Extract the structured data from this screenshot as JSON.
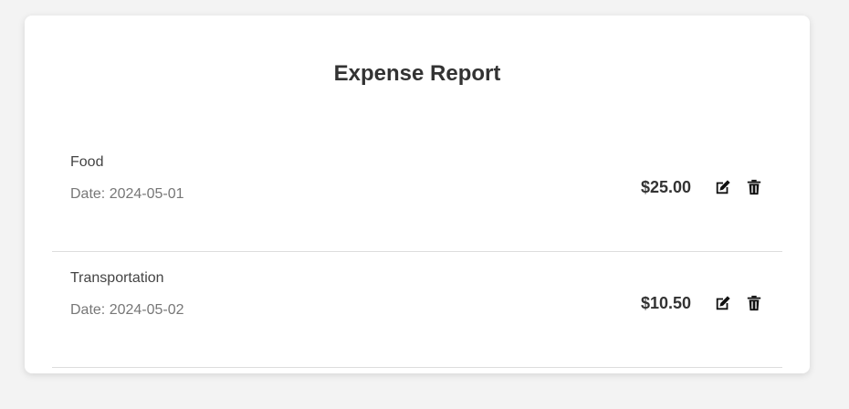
{
  "page": {
    "title": "Expense Report"
  },
  "expenses": [
    {
      "name": "Food",
      "date": "Date: 2024-05-01",
      "amount": "$25.00"
    },
    {
      "name": "Transportation",
      "date": "Date: 2024-05-02",
      "amount": "$10.50"
    }
  ],
  "icons": {
    "edit": "edit-icon",
    "delete": "trash-icon"
  }
}
